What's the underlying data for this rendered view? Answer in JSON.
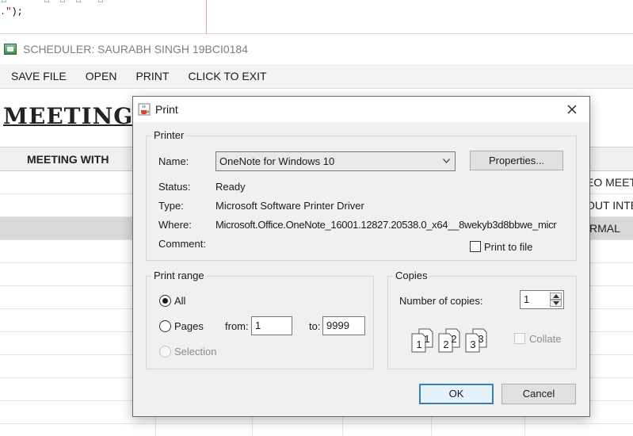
{
  "editor": {
    "code_prefix": ".\"",
    "code_suffix": ");"
  },
  "window": {
    "title": "SCHEDULER: SAURABH SINGH 19BCI0184"
  },
  "menu": [
    "SAVE FILE",
    "OPEN",
    "PRINT",
    "CLICK TO EXIT"
  ],
  "main": {
    "heading": "MEETING OR",
    "table": {
      "header_col1": "MEETING WITH",
      "peek_cells": [
        "EO MEET",
        "OUT INTE",
        "RMAL"
      ]
    }
  },
  "dialog": {
    "title": "Print",
    "printer": {
      "group_label": "Printer",
      "name_label": "Name:",
      "name_value": "OneNote for Windows 10",
      "properties_button": "Properties...",
      "status_label": "Status:",
      "status_value": "Ready",
      "type_label": "Type:",
      "type_value": "Microsoft Software Printer Driver",
      "where_label": "Where:",
      "where_value": "Microsoft.Office.OneNote_16001.12827.20538.0_x64__8wekyb3d8bbwe_micr",
      "comment_label": "Comment:",
      "print_to_file_label": "Print to file"
    },
    "print_range": {
      "group_label": "Print range",
      "all_label": "All",
      "pages_label": "Pages",
      "from_label": "from:",
      "from_value": "1",
      "to_label": "to:",
      "to_value": "9999",
      "selection_label": "Selection"
    },
    "copies": {
      "group_label": "Copies",
      "number_label": "Number of copies:",
      "number_value": "1",
      "collate_label": "Collate",
      "collate_numbers": [
        "1",
        "1",
        "2",
        "2",
        "3",
        "3"
      ]
    },
    "ok_button": "OK",
    "cancel_button": "Cancel"
  },
  "colors": {
    "default_button_border": "#3c7fb1",
    "selected_row": "#d9d9d9",
    "editor_string": "#c00000"
  }
}
